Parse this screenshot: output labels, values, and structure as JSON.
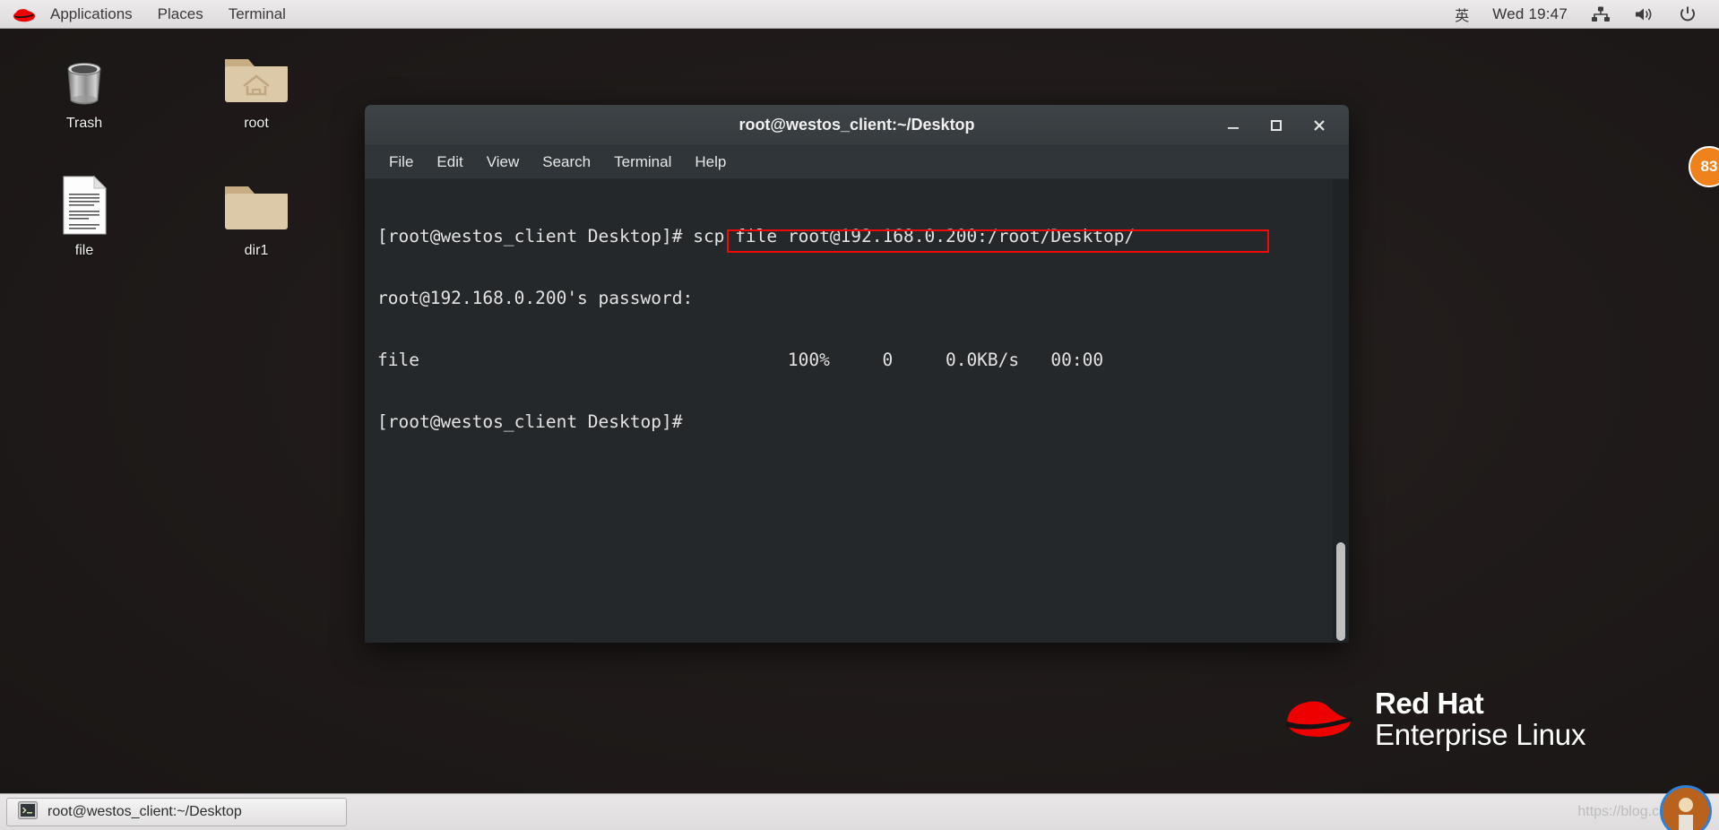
{
  "top_panel": {
    "logo_icon": "redhat-logo-icon",
    "menus": [
      {
        "label": "Applications",
        "name": "applications-menu"
      },
      {
        "label": "Places",
        "name": "places-menu"
      },
      {
        "label": "Terminal",
        "name": "terminal-menu"
      }
    ],
    "indicators": {
      "input_method": "英",
      "clock": "Wed 19:47",
      "network_icon": "network-icon",
      "volume_icon": "volume-icon",
      "power_icon": "power-icon"
    }
  },
  "desktop": {
    "icons": [
      {
        "label": "Trash",
        "icon": "trash-icon",
        "name": "desktop-icon-trash"
      },
      {
        "label": "root",
        "icon": "home-folder-icon",
        "name": "desktop-icon-root"
      },
      {
        "label": "file",
        "icon": "document-icon",
        "name": "desktop-icon-file"
      },
      {
        "label": "dir1",
        "icon": "folder-icon",
        "name": "desktop-icon-dir1"
      }
    ],
    "branding": {
      "line1": "Red Hat",
      "line2": "Enterprise Linux",
      "logo_icon": "redhat-fedora-icon"
    },
    "side_badge": "83"
  },
  "terminal": {
    "title": "root@westos_client:~/Desktop",
    "window_buttons": {
      "minimize": "−",
      "maximize": "▢",
      "close": "✕"
    },
    "menu": [
      {
        "label": "File",
        "name": "terminal-menu-file"
      },
      {
        "label": "Edit",
        "name": "terminal-menu-edit"
      },
      {
        "label": "View",
        "name": "terminal-menu-view"
      },
      {
        "label": "Search",
        "name": "terminal-menu-search"
      },
      {
        "label": "Terminal",
        "name": "terminal-menu-terminal"
      },
      {
        "label": "Help",
        "name": "terminal-menu-help"
      }
    ],
    "lines": [
      "[root@westos_client Desktop]# scp file root@192.168.0.200:/root/Desktop/",
      "root@192.168.0.200's password:",
      "file                                   100%     0     0.0KB/s   00:00",
      "[root@westos_client Desktop]#"
    ],
    "highlighted_command": "scp file root@192.168.0.200:/root/Desktop/",
    "highlight_color": "#f40707"
  },
  "taskbar": {
    "window_button": {
      "label": "root@westos_client:~/Desktop",
      "icon": "terminal-icon"
    },
    "watermark": "https://blog.csdn.net/"
  }
}
